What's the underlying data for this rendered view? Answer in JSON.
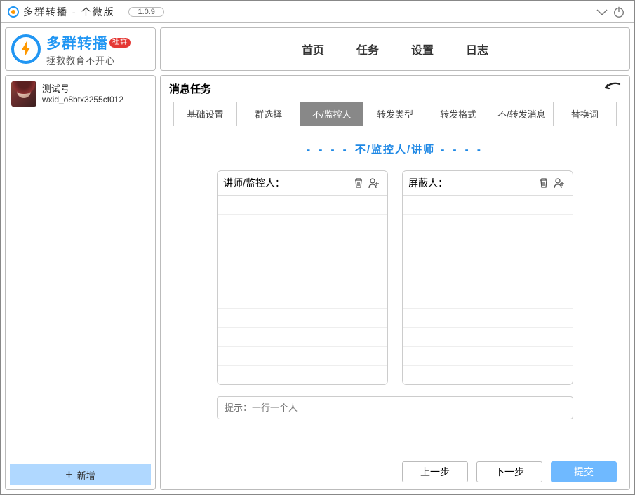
{
  "window": {
    "title": "多群转播 - 个微版",
    "version": "1.0.9"
  },
  "logo": {
    "name": "多群转播",
    "badge": "社群",
    "subtitle": "拯救教育不开心"
  },
  "account": {
    "name": "测试号",
    "wxid": "wxid_o8btx3255cf012"
  },
  "sidebar": {
    "new_button": "新增"
  },
  "nav": {
    "items": [
      "首页",
      "任务",
      "设置",
      "日志"
    ]
  },
  "content": {
    "title": "消息任务",
    "tabs": [
      "基础设置",
      "群选择",
      "不/监控人",
      "转发类型",
      "转发格式",
      "不/转发消息",
      "替换词"
    ],
    "active_tab_index": 2,
    "section_title": "不/监控人/讲师",
    "list_left_label": "讲师/监控人：",
    "list_right_label": "屏蔽人：",
    "hint_placeholder": "提示：一行一个人",
    "prev_button": "上一步",
    "next_button": "下一步",
    "submit_button": "提交"
  }
}
